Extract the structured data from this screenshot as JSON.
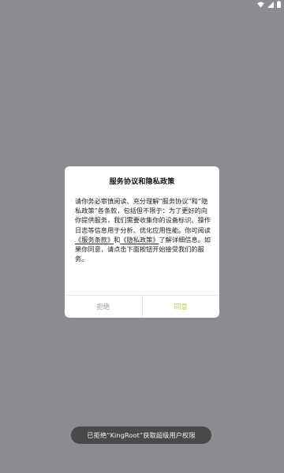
{
  "status_bar": {
    "icons": [
      "wifi-icon",
      "signal-icon",
      "battery-icon"
    ]
  },
  "dialog": {
    "title": "服务协议和隐私政策",
    "body_before_links": "请你务必审慎阅读、充分理解“服务协议”和“隐私政策”各条款，包括但不限于：为了更好的向你提供服务，我们需要收集你的设备标识、操作日志等信息用于分析、优化应用性能。你可阅读",
    "service_link": "《服务条款》",
    "link_joiner": "和",
    "privacy_link": "《隐私政策》",
    "body_after_links": "了解详细信息。如果你同意，请点击下面按钮开始接受我们的服务。",
    "reject_label": "拒绝",
    "agree_label": "同意"
  },
  "toast": {
    "message": "已拒绝“KingRoot”获取超级用户权限"
  },
  "colors": {
    "backdrop": "#8b8c8f",
    "agree": "#a8d34a",
    "reject": "#9c9c9c"
  }
}
